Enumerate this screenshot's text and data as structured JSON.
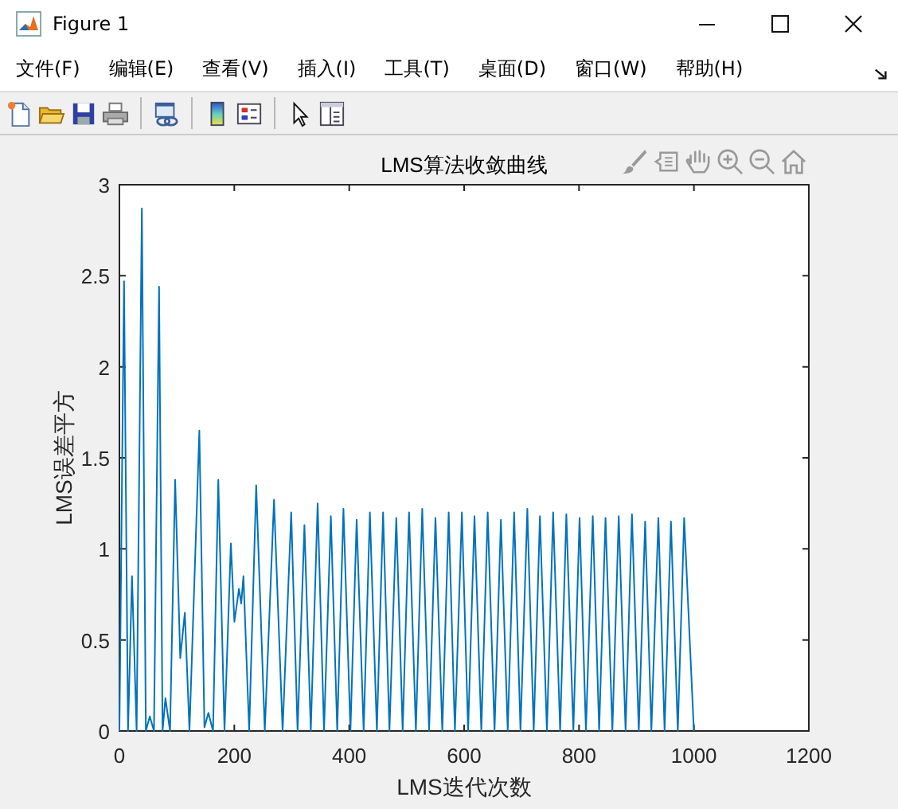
{
  "window": {
    "title": "Figure 1"
  },
  "menu": [
    {
      "label": "文件(F)"
    },
    {
      "label": "编辑(E)"
    },
    {
      "label": "查看(V)"
    },
    {
      "label": "插入(I)"
    },
    {
      "label": "工具(T)"
    },
    {
      "label": "桌面(D)"
    },
    {
      "label": "窗口(W)"
    },
    {
      "label": "帮助(H)"
    }
  ],
  "toolbar": [
    {
      "kind": "new"
    },
    {
      "kind": "open"
    },
    {
      "kind": "save"
    },
    {
      "kind": "print"
    },
    {
      "kind": "separator"
    },
    {
      "kind": "link"
    },
    {
      "kind": "separator"
    },
    {
      "kind": "colorbar"
    },
    {
      "kind": "legend"
    },
    {
      "kind": "separator"
    },
    {
      "kind": "pointer"
    },
    {
      "kind": "panel"
    }
  ],
  "axes_toolbar": [
    {
      "kind": "brush"
    },
    {
      "kind": "datatip"
    },
    {
      "kind": "pan"
    },
    {
      "kind": "zoom_in"
    },
    {
      "kind": "zoom_out"
    },
    {
      "kind": "home"
    }
  ],
  "figure": {
    "chart_data": {
      "type": "line",
      "title": "LMS算法收敛曲线",
      "xlabel": "LMS迭代次数",
      "ylabel": "LMS误差平方",
      "xlim": [
        0,
        1200
      ],
      "ylim": [
        0,
        3
      ],
      "xticks": [
        0,
        200,
        400,
        600,
        800,
        1000,
        1200
      ],
      "yticks": [
        0,
        0.5,
        1,
        1.5,
        2,
        2.5,
        3
      ],
      "x": [
        0,
        8,
        15,
        22,
        30,
        39,
        46,
        53,
        60,
        69,
        75,
        80,
        88,
        97,
        106,
        114,
        122,
        139,
        148,
        155,
        163,
        172,
        183,
        194,
        200,
        208,
        212,
        216,
        226,
        238,
        253,
        269,
        284,
        299,
        310,
        322,
        333,
        345,
        356,
        368,
        379,
        390,
        402,
        413,
        425,
        436,
        448,
        459,
        470,
        482,
        493,
        504,
        516,
        527,
        539,
        550,
        562,
        573,
        584,
        596,
        607,
        618,
        630,
        641,
        653,
        664,
        676,
        687,
        698,
        710,
        721,
        732,
        744,
        755,
        767,
        778,
        790,
        801,
        812,
        824,
        835,
        846,
        858,
        869,
        881,
        892,
        904,
        915,
        926,
        938,
        949,
        960,
        972,
        983,
        1000
      ],
      "series": [
        {
          "color": "#0072bd",
          "values": [
            0,
            2.47,
            0,
            0.85,
            0,
            2.87,
            0,
            0.08,
            0,
            2.44,
            0,
            0.18,
            0,
            1.38,
            0.4,
            0.65,
            0,
            1.65,
            0.02,
            0.1,
            0,
            1.38,
            0,
            1.03,
            0.6,
            0.78,
            0.7,
            0.85,
            0,
            1.35,
            0,
            1.27,
            0,
            1.2,
            0,
            1.13,
            0,
            1.25,
            0,
            1.18,
            0,
            1.22,
            0,
            1.16,
            0,
            1.2,
            0,
            1.2,
            0,
            1.17,
            0,
            1.2,
            0,
            1.22,
            0,
            1.17,
            0,
            1.2,
            0,
            1.2,
            0,
            1.18,
            0,
            1.2,
            0,
            1.16,
            0,
            1.2,
            0,
            1.22,
            0,
            1.18,
            0,
            1.2,
            0,
            1.19,
            0,
            1.17,
            0,
            1.18,
            0,
            1.17,
            0,
            1.18,
            0,
            1.19,
            0,
            1.15,
            0,
            1.17,
            0,
            1.15,
            0,
            1.17,
            0
          ]
        }
      ]
    }
  }
}
